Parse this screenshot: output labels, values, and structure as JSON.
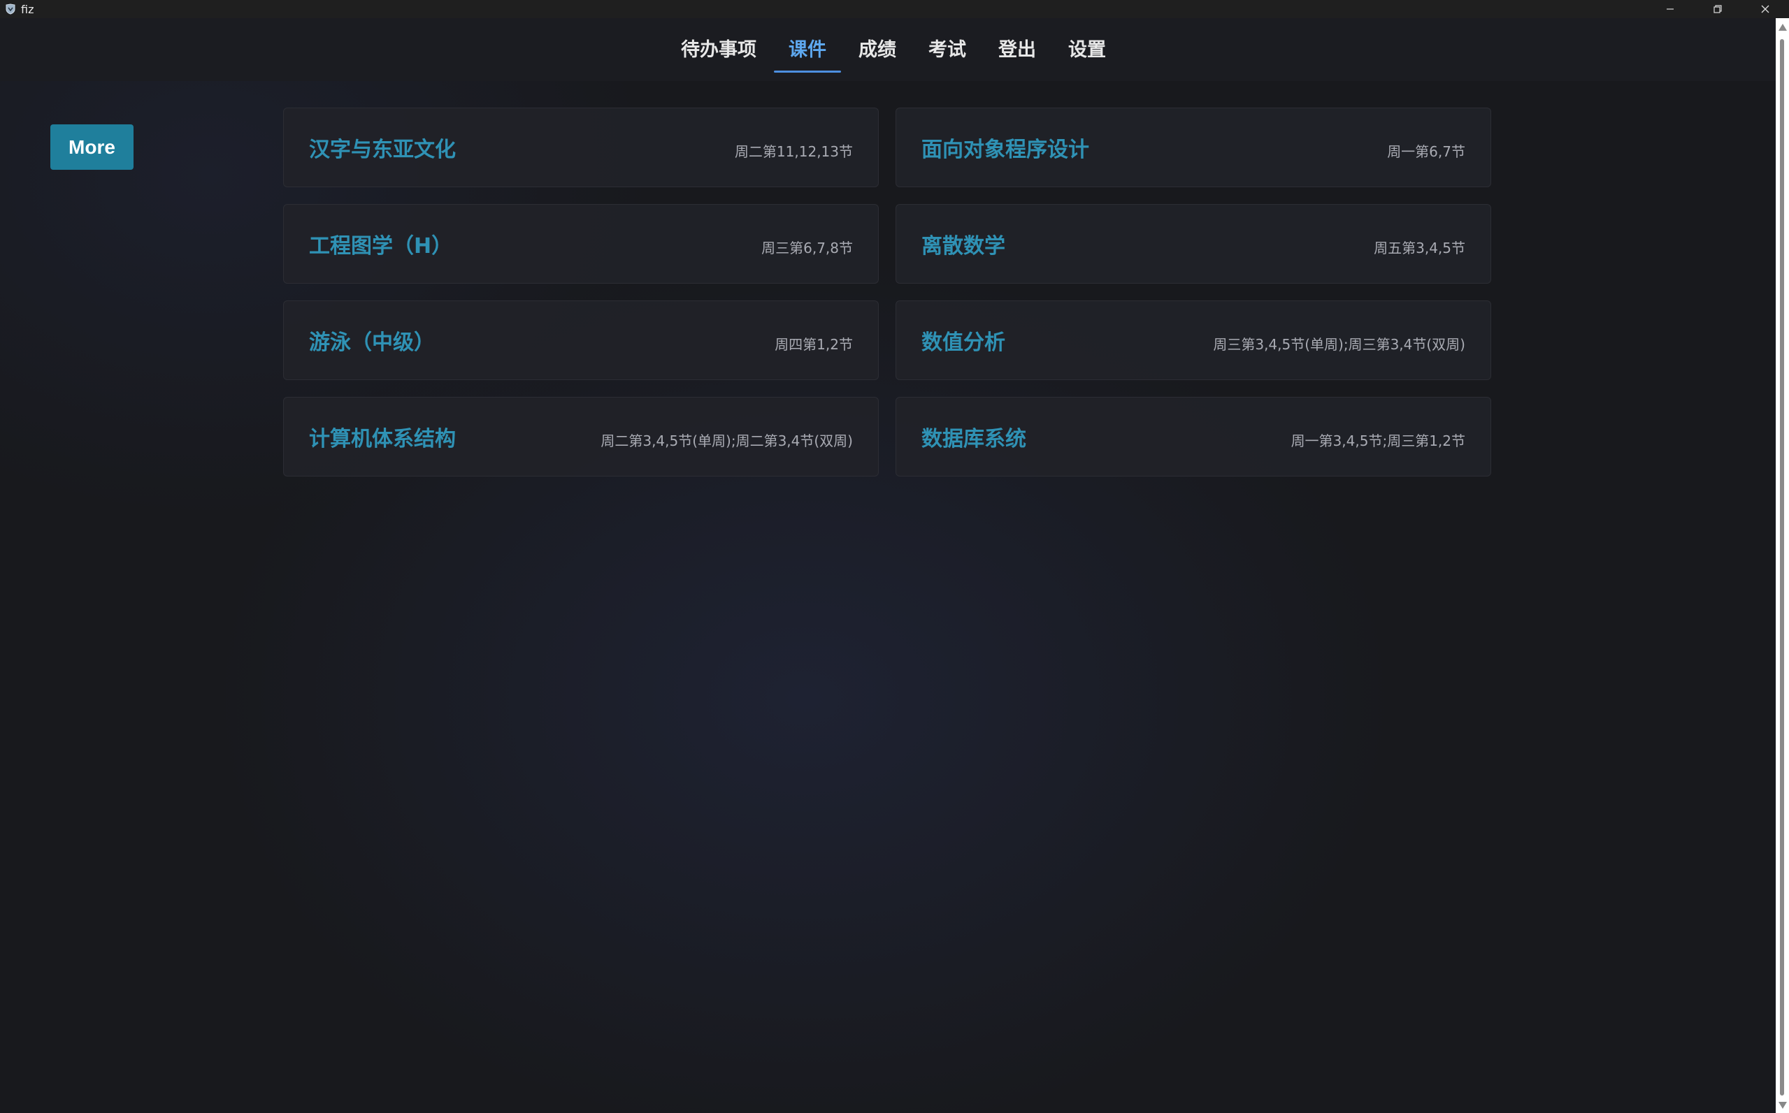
{
  "window": {
    "title": "fiz",
    "icon": "app-logo-icon"
  },
  "nav": {
    "items": [
      {
        "label": "待办事项",
        "active": false
      },
      {
        "label": "课件",
        "active": true
      },
      {
        "label": "成绩",
        "active": false
      },
      {
        "label": "考试",
        "active": false
      },
      {
        "label": "登出",
        "active": false
      },
      {
        "label": "设置",
        "active": false
      }
    ]
  },
  "sidebar": {
    "more_label": "More"
  },
  "courses": [
    {
      "title": "汉字与东亚文化",
      "time": "周二第11,12,13节"
    },
    {
      "title": "面向对象程序设计",
      "time": "周一第6,7节"
    },
    {
      "title": "工程图学（H）",
      "time": "周三第6,7,8节"
    },
    {
      "title": "离散数学",
      "time": "周五第3,4,5节"
    },
    {
      "title": "游泳（中级）",
      "time": "周四第1,2节"
    },
    {
      "title": "数值分析",
      "time": "周三第3,4,5节(单周);周三第3,4节(双周)"
    },
    {
      "title": "计算机体系结构",
      "time": "周二第3,4,5节(单周);周二第3,4节(双周)"
    },
    {
      "title": "数据库系统",
      "time": "周一第3,4,5节;周三第1,2节"
    }
  ],
  "colors": {
    "accent": "#5ea8ef",
    "course_title": "#2f92b5",
    "more_button": "#1f7f9c",
    "background": "#18191d"
  }
}
